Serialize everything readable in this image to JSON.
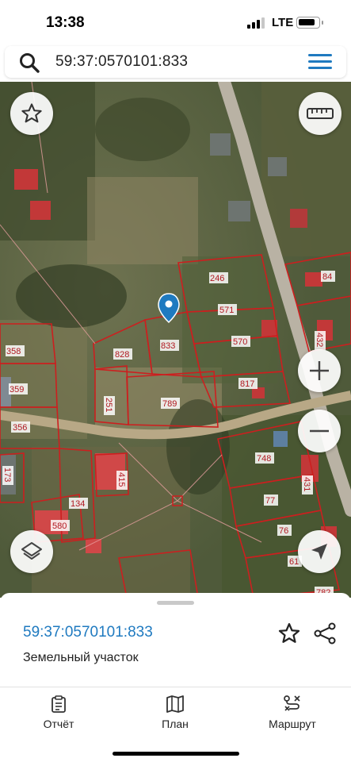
{
  "status_bar": {
    "time": "13:38",
    "network": "LTE",
    "signal_bars_active": 3,
    "signal_bars_total": 4
  },
  "search": {
    "query": "59:37:0570101:833",
    "search_icon": "search-icon",
    "menu_icon": "hamburger-menu-icon"
  },
  "map": {
    "type": "satellite",
    "selected_plot": "833",
    "plot_numbers": [
      "246",
      "571",
      "570",
      "817",
      "833",
      "828",
      "251",
      "789",
      "358",
      "359",
      "356",
      "173",
      "134",
      "580",
      "415",
      "748",
      "431",
      "77",
      "76",
      "84",
      "432",
      "61",
      "782"
    ],
    "controls": {
      "favorite": "star-icon",
      "ruler": "ruler-icon",
      "zoom_in": "plus-icon",
      "zoom_out": "minus-icon",
      "layers": "layers-icon",
      "locate": "navigation-arrow-icon"
    },
    "colors": {
      "boundary": "#cc1f1f",
      "marker": "#1f7ac0",
      "road": "#b9b2a4"
    }
  },
  "bottom_sheet": {
    "title": "59:37:0570101:833",
    "subtitle": "Земельный участок",
    "favorite_icon": "star-outline-icon",
    "share_icon": "share-icon"
  },
  "tabs": [
    {
      "label": "Отчёт",
      "icon": "clipboard-icon"
    },
    {
      "label": "План",
      "icon": "map-book-icon"
    },
    {
      "label": "Маршрут",
      "icon": "route-icon"
    }
  ],
  "accent_color": "#1f7ac0"
}
